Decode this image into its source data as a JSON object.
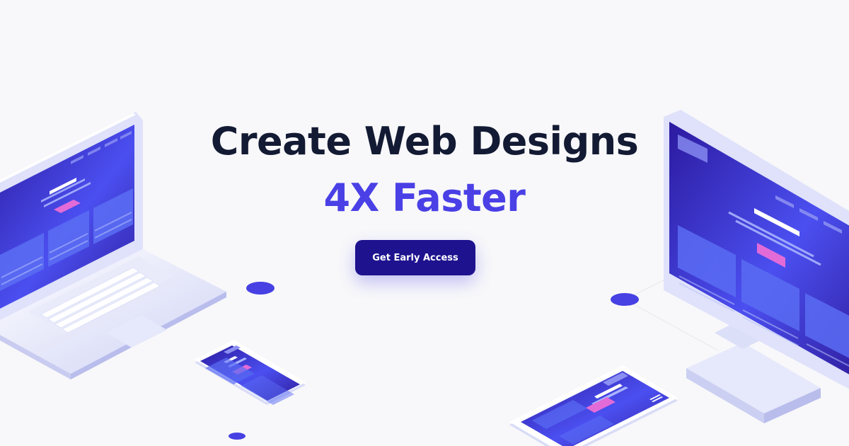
{
  "hero": {
    "headline_line1": "Create Web Designs",
    "headline_line2": "4X Faster",
    "cta_label": "Get Early Access"
  },
  "colors": {
    "background": "#f8f8fa",
    "headline": "#131a33",
    "accent": "#4a40e6",
    "button": "#1e128f"
  },
  "illustrations": [
    "laptop-icon",
    "desktop-monitor-icon",
    "phone-icon",
    "tablet-icon"
  ]
}
